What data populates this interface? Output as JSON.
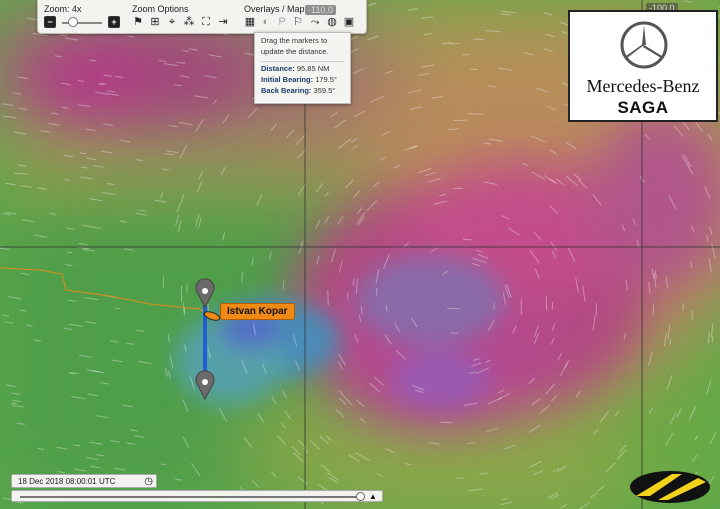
{
  "toolbar": {
    "zoom_label": "Zoom: 4x",
    "zoom_options_label": "Zoom Options",
    "overlays_label": "Overlays / Map",
    "minus": "−",
    "plus": "+"
  },
  "coord_tags": {
    "top_center": "-110.0",
    "top_right": "-100.0"
  },
  "distance_popup": {
    "instructions": "Drag the markers to update the distance.",
    "distance_label": "Distance:",
    "distance_value": "95.85 NM",
    "initial_bearing_label": "Initial Bearing:",
    "initial_bearing_value": "179.5°",
    "back_bearing_label": "Back Bearing:",
    "back_bearing_value": "359.5°"
  },
  "sponsor": {
    "brand": "Mercedes-Benz",
    "name": "SAGA"
  },
  "boat": {
    "label": "Istvan Kopar",
    "accent": "#f08a16"
  },
  "timestamp": "18 Dec 2018 08:00:01 UTC",
  "icons": {
    "zoom_options": [
      "flag-icon",
      "expand-icon",
      "crosshair-icon",
      "fleet-icon",
      "fullscreen-icon",
      "exit-icon"
    ],
    "overlays": [
      "grid-icon",
      "moon-icon",
      "pressure-icon",
      "flag-overlay-icon",
      "track-icon",
      "globe-icon",
      "map-layer-icon"
    ]
  }
}
